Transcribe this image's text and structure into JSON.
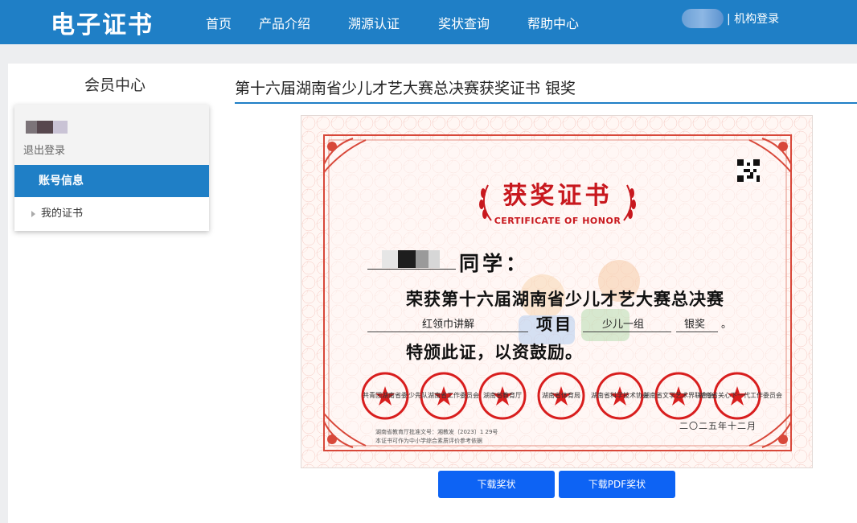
{
  "header": {
    "logo": "电子证书",
    "nav": [
      "首页",
      "产品介绍",
      "溯源认证",
      "奖状查询",
      "帮助中心"
    ],
    "login_link": "| 机构登录"
  },
  "sidebar": {
    "title": "会员中心",
    "logout": "退出登录",
    "active_item": "账号信息",
    "items": [
      "我的证书"
    ]
  },
  "main": {
    "page_title": "第十六届湖南省少儿才艺大赛总决赛获奖证书 银奖"
  },
  "certificate": {
    "title": "获奖证书",
    "subtitle": "CERTIFICATE OF HONOR",
    "tongxue": "同学：",
    "line1": "荣获第十六届湖南省少儿才艺大赛总决赛",
    "project_name": "红领巾讲解",
    "project_label": "项目",
    "group": "少儿一组",
    "award": "银奖",
    "end_mark": "。",
    "line3": "特颁此证，以资鼓励。",
    "seal_captions": [
      "共青团湖南省委",
      "少先队湖南省工作委员会",
      "湖南省教育厅",
      "湖南省体育局",
      "湖南省科学技术协会",
      "湖南省文学艺术界联合会",
      "湖南省关心下一代工作委员会"
    ],
    "date": "二〇二五年十二月",
    "footnote_1": "湖南省教育厅批准文号：湘教发〔2023〕1 29号",
    "footnote_2": "本证书可作为中小学综合素质评价参考依据"
  },
  "buttons": {
    "download": "下载奖状",
    "download_pdf": "下载PDF奖状"
  },
  "colors": {
    "brand_blue": "#1f7fc6",
    "button_blue": "#0d63f4",
    "seal_red": "#d81e1e",
    "cert_red": "#c8181e"
  }
}
